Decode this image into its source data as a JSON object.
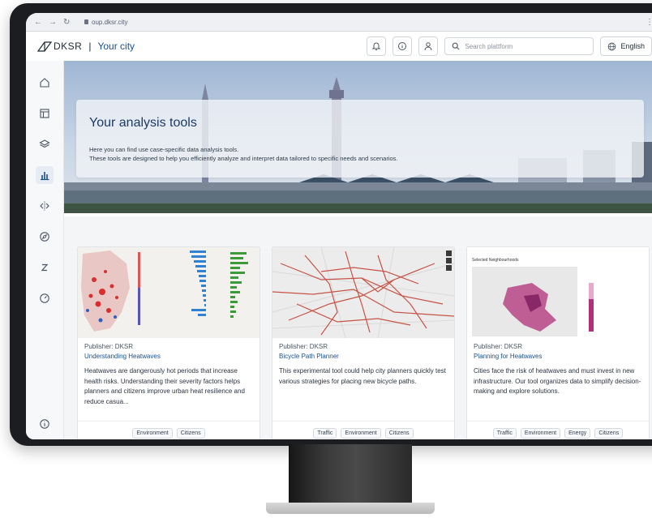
{
  "browser": {
    "url": "oup.dksr.city"
  },
  "header": {
    "logo_text": "DKSR",
    "separator": "|",
    "city": "Your city",
    "search_placeholder": "Search plattform",
    "language": "English"
  },
  "hero": {
    "title": "Your analysis tools",
    "line1": "Here you can find use case-specific data analysis tools.",
    "line2": "These tools are designed to help you efficiently analyze and interpret data tailored to specific needs and scenarios."
  },
  "cards": [
    {
      "publisher": "Publisher: DKSR",
      "title": "Understanding Heatwaves",
      "description": "Heatwaves are dangerously hot periods that increase health risks. Understanding their severity factors helps planners and citizens improve urban heat resilience and reduce casua...",
      "tags": [
        "Environment",
        "Citizens"
      ]
    },
    {
      "publisher": "Publisher: DKSR",
      "title": "Bicycle Path Planner",
      "description": "This experimental tool could help city planners quickly test various strategies for placing new bicycle paths.",
      "tags": [
        "Traffic",
        "Environment",
        "Citizens"
      ]
    },
    {
      "publisher": "Publisher: DKSR",
      "title": "Planning for Heatwaves",
      "description": "Cities face the risk of heatwaves and must invest in new infrastructure. Our tool organizes data to simplify decision-making and explore solutions.",
      "thumb_heading": "Selected Neighbourhoods",
      "tags": [
        "Traffic",
        "Environment",
        "Energy",
        "Citizens"
      ]
    }
  ],
  "colors": {
    "accent": "#1c4f8a",
    "title": "#1c3a66",
    "map_route": "#c0392b",
    "heat_pink": "#b0307a"
  }
}
